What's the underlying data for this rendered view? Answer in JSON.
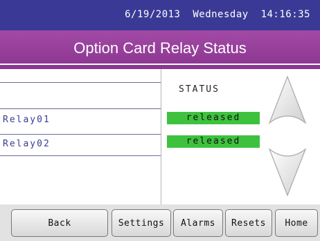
{
  "header": {
    "date": "6/19/2013",
    "weekday": "Wednesday",
    "time": "14:16:35"
  },
  "title": "Option Card Relay Status",
  "table": {
    "status_header": "STATUS",
    "rows": [
      {
        "name": "Relay01",
        "status": "released"
      },
      {
        "name": "Relay02",
        "status": "released"
      }
    ]
  },
  "scroll": {
    "up_icon": "chevron-up-icon",
    "down_icon": "chevron-down-icon"
  },
  "buttons": {
    "back": "Back",
    "settings": "Settings",
    "alarms": "Alarms",
    "resets": "Resets",
    "home": "Home"
  },
  "colors": {
    "topbar": "#3a3a96",
    "titlebar": "#9a3f9e",
    "status_ok": "#3ec23e"
  }
}
